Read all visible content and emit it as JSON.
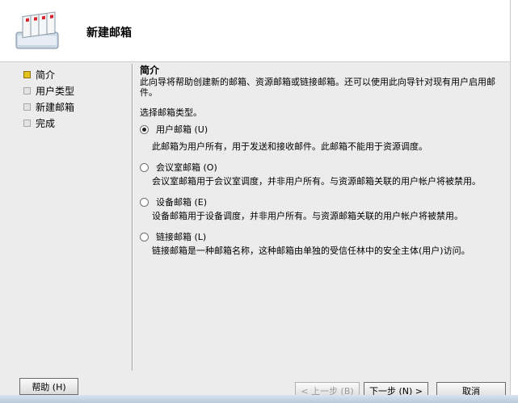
{
  "window": {
    "title": "新建邮箱"
  },
  "steps": [
    {
      "label": "简介",
      "active": true
    },
    {
      "label": "用户类型",
      "active": false
    },
    {
      "label": "新建邮箱",
      "active": false
    },
    {
      "label": "完成",
      "active": false
    }
  ],
  "content": {
    "heading": "简介",
    "intro": "此向导将帮助创建新的邮箱、资源邮箱或链接邮箱。还可以使用此向导针对现有用户启用邮件。",
    "prompt": "选择邮箱类型。",
    "options": [
      {
        "label": "用户邮箱 (U)",
        "checked": true,
        "description": "此邮箱为用户所有，用于发送和接收邮件。此邮箱不能用于资源调度。"
      },
      {
        "label": "会议室邮箱 (O)",
        "checked": false,
        "description": "会议室邮箱用于会议室调度，并非用户所有。与资源邮箱关联的用户帐户将被禁用。"
      },
      {
        "label": "设备邮箱 (E)",
        "checked": false,
        "description": "设备邮箱用于设备调度，并非用户所有。与资源邮箱关联的用户帐户将被禁用。"
      },
      {
        "label": "链接邮箱 (L)",
        "checked": false,
        "description": "链接邮箱是一种邮箱名称，这种邮箱由单独的受信任林中的安全主体(用户)访问。"
      }
    ]
  },
  "buttons": {
    "help": "帮助 (H)",
    "back": "< 上一步 (B)",
    "next": "下一步 (N) >",
    "cancel": "取消"
  },
  "colors": {
    "active_step": "#e6c21c",
    "background": "#ececec"
  }
}
